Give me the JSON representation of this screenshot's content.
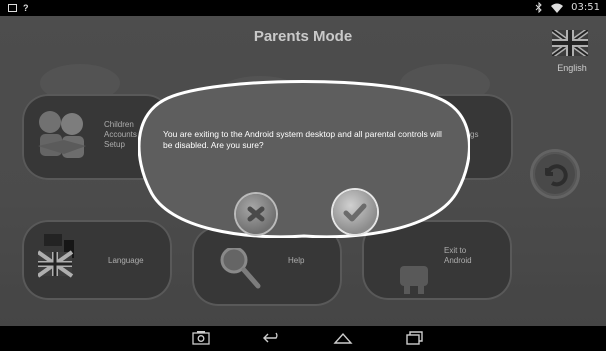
{
  "status_bar": {
    "time": "03:51",
    "left_icons": [
      "image-icon",
      "question-icon"
    ],
    "right_icons": [
      "bluetooth-icon",
      "wifi-icon"
    ]
  },
  "header": {
    "title": "Parents Mode",
    "language": {
      "label": "English",
      "icon": "uk-flag-icon"
    }
  },
  "menu": {
    "children_accounts_setup": "Children\nAccounts\nSetup",
    "settings_partial": "gs",
    "language": "Language",
    "help": "Help",
    "exit_to_android": "Exit to\nAndroid"
  },
  "dialog": {
    "message": "You are exiting to the Android system desktop and all parental controls will be disabled. Are you sure?",
    "cancel_icon": "close-icon",
    "confirm_icon": "checkmark-icon"
  },
  "nav_bar": {
    "buttons": [
      "screenshot-icon",
      "back-icon",
      "home-icon",
      "recents-icon"
    ]
  },
  "colors": {
    "background": "#575757",
    "tile": "#3d3d3d",
    "dialog_border": "#ffffff"
  }
}
